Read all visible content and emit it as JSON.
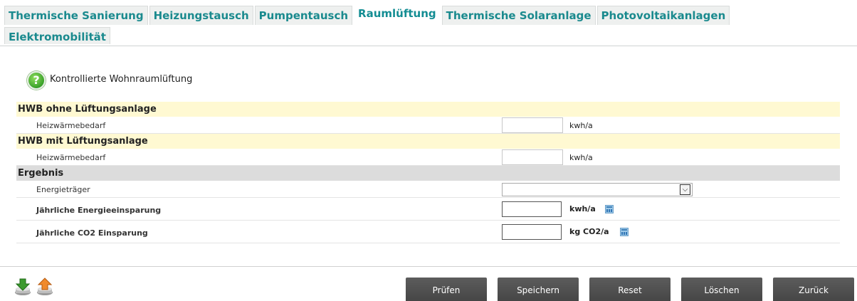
{
  "tabs": [
    {
      "label": "Thermische Sanierung",
      "active": false
    },
    {
      "label": "Heizungstausch",
      "active": false
    },
    {
      "label": "Pumpentausch",
      "active": false
    },
    {
      "label": "Raumlüftung",
      "active": true
    },
    {
      "label": "Thermische Solaranlage",
      "active": false
    },
    {
      "label": "Photovoltaikanlagen",
      "active": false
    },
    {
      "label": "Elektromobilität",
      "active": false
    }
  ],
  "header": {
    "title": "Kontrollierte Wohnraumlüftung",
    "help_icon": "question-mark-icon"
  },
  "sections": {
    "ohne": {
      "title": "HWB ohne Lüftungsanlage",
      "field_label": "Heizwärmebedarf",
      "value": "",
      "unit": "kwh/a"
    },
    "mit": {
      "title": "HWB mit Lüftungsanlage",
      "field_label": "Heizwärmebedarf",
      "value": "",
      "unit": "kwh/a"
    },
    "ergebnis": {
      "title": "Ergebnis",
      "energietraeger_label": "Energieträger",
      "energietraeger_value": "",
      "energie_label": "Jährliche Energieeinsparung",
      "energie_value": "",
      "energie_unit": "kwh/a",
      "co2_label": "Jährliche CO2 Einsparung",
      "co2_value": "",
      "co2_unit": "kg CO2/a"
    }
  },
  "buttons": {
    "pruefen": "Prüfen",
    "speichern": "Speichern",
    "reset": "Reset",
    "loeschen": "Löschen",
    "zurueck": "Zurück"
  },
  "colors": {
    "tab_text": "#1a8a8e",
    "yellow_header": "#fff9d2",
    "gray_header": "#dcdcdc",
    "button_bg": "#4f4f4f"
  }
}
